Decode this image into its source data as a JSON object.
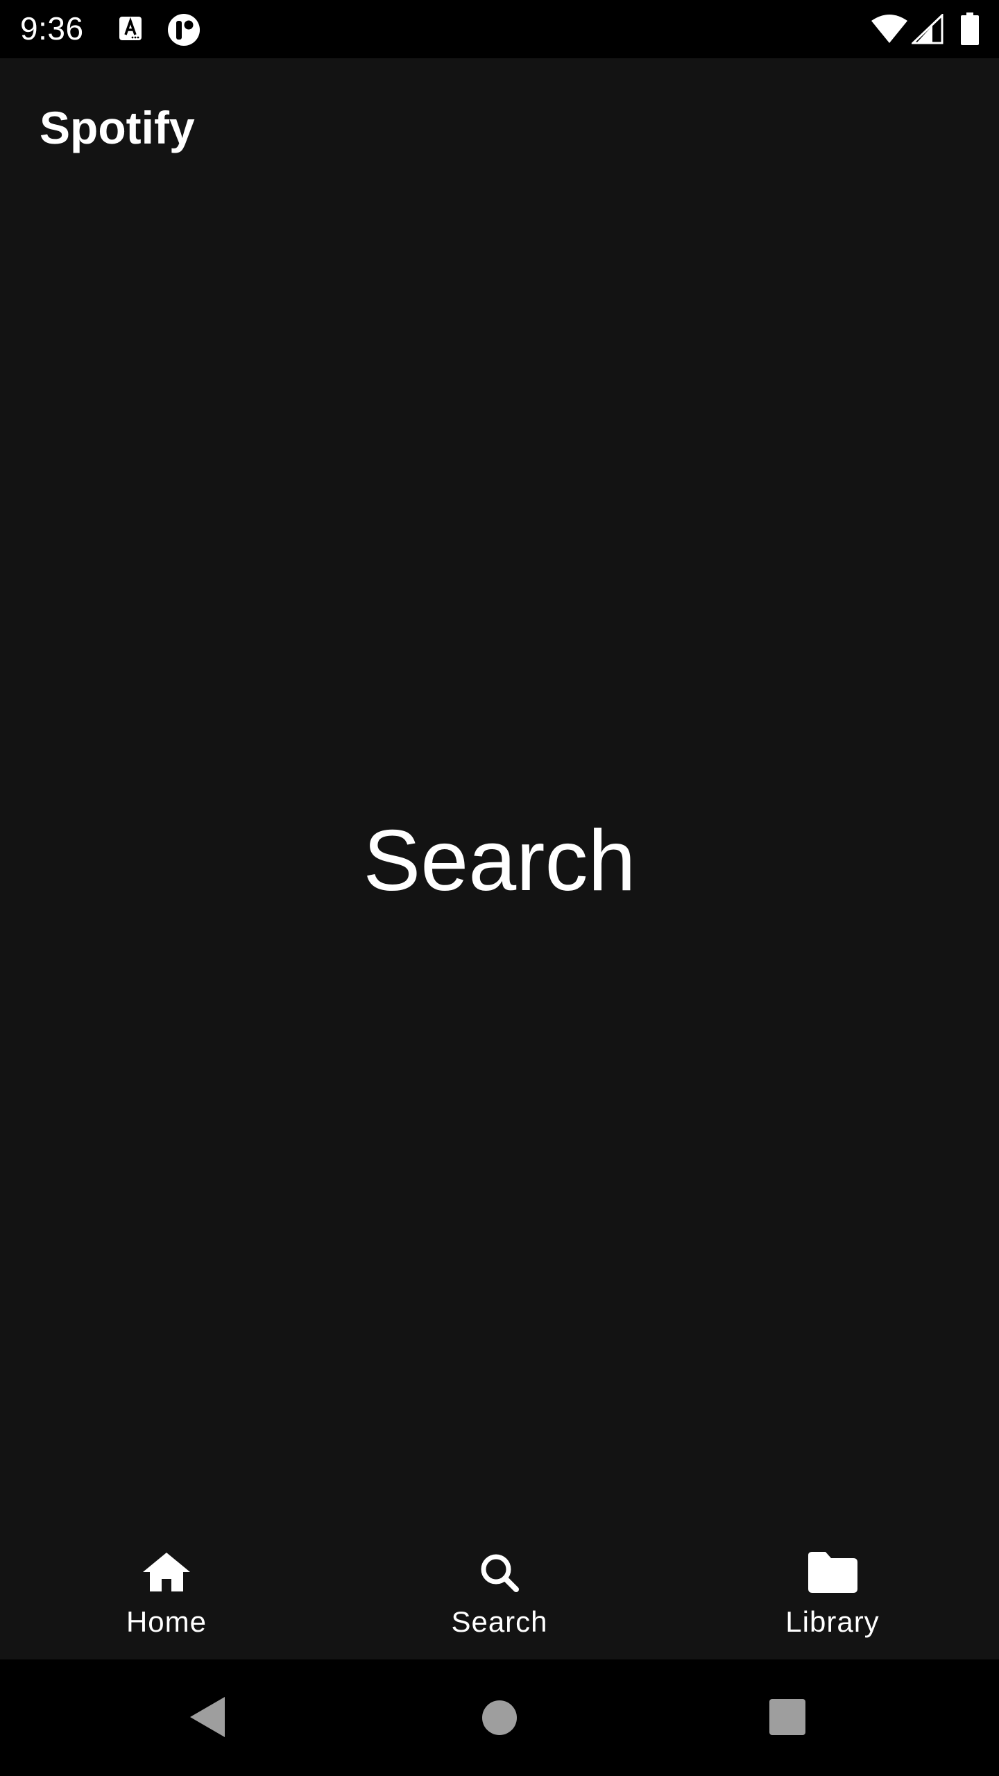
{
  "status_bar": {
    "time": "9:36",
    "icons": [
      "text-notification-icon",
      "app-notification-icon",
      "wifi-icon",
      "signal-icon",
      "battery-icon"
    ]
  },
  "app_bar": {
    "title": "Spotify"
  },
  "main": {
    "center_text": "Search"
  },
  "bottom_nav": {
    "items": [
      {
        "label": "Home",
        "icon": "home-icon"
      },
      {
        "label": "Search",
        "icon": "search-icon"
      },
      {
        "label": "Library",
        "icon": "folder-icon"
      }
    ]
  },
  "system_nav": {
    "buttons": [
      "back-button",
      "home-button",
      "recents-button"
    ]
  },
  "colors": {
    "background": "#131313",
    "bars": "#000000",
    "text": "#ffffff",
    "system_buttons": "#9e9e9e"
  }
}
